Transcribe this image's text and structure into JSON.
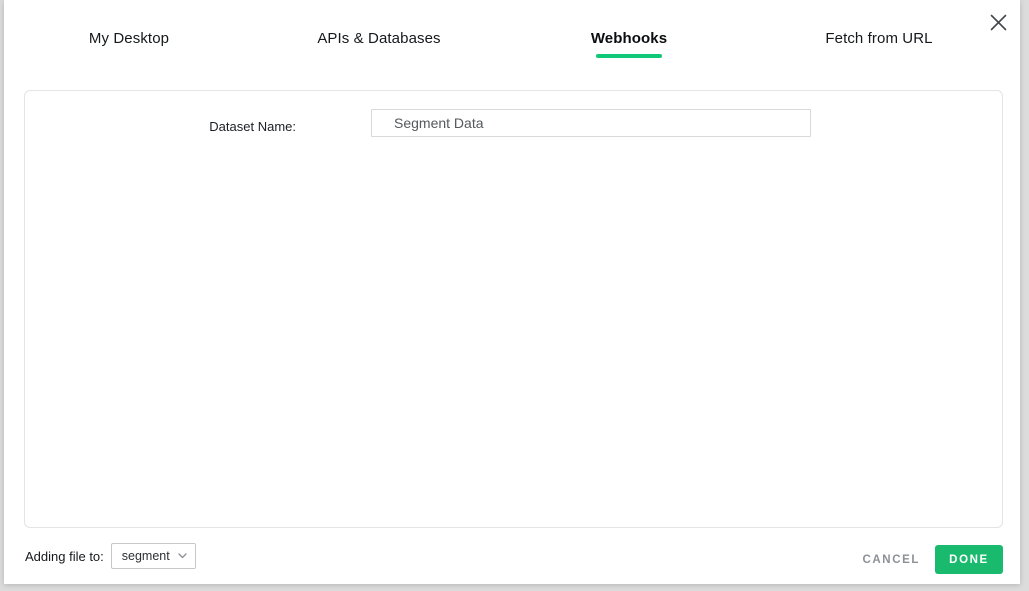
{
  "modal": {
    "tabs": [
      {
        "label": "My Desktop",
        "active": false
      },
      {
        "label": "APIs & Databases",
        "active": false
      },
      {
        "label": "Webhooks",
        "active": true
      },
      {
        "label": "Fetch from URL",
        "active": false
      }
    ],
    "form": {
      "dataset_name_label": "Dataset Name:",
      "dataset_name_value": "Segment Data"
    },
    "footer": {
      "adding_file_label": "Adding file to:",
      "folder_select": {
        "value": "segment"
      },
      "cancel_label": "CANCEL",
      "done_label": "DONE"
    },
    "colors": {
      "accent_green": "#10c878",
      "done_button_green": "#19ba6e"
    }
  }
}
